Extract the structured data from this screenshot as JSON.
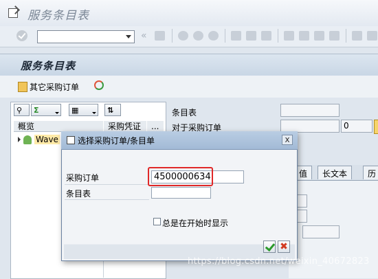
{
  "window": {
    "title": "服务条目表"
  },
  "toolbar": {
    "command_field_value": "",
    "nav_glyph": "«"
  },
  "screen": {
    "header": "服务条目表"
  },
  "app_toolbar": {
    "other_po_label": "其它采购订单"
  },
  "tree": {
    "col_overview": "概览",
    "col_po": "采购凭证",
    "col_more": "...",
    "row_label": "Wave"
  },
  "form": {
    "entry_sheet_label": "条目表",
    "for_po_label": "对于采购订单",
    "for_po_item": "0",
    "tabs": [
      "值",
      "长文本",
      "历"
    ]
  },
  "dialog": {
    "title": "选择采购订单/条目单",
    "close_glyph": "x",
    "po_label": "采购订单",
    "po_value": "4500000634",
    "entry_sheet_label": "条目表",
    "entry_sheet_value": "",
    "checkbox_label": "总是在开始时显示",
    "checkbox_checked": false,
    "cancel_glyph": "✖"
  },
  "watermark": "https://blog.csdn.net/weixin_40672823",
  "colors": {
    "highlight": "#e02828",
    "header_band": "#c8d6e5",
    "ok_green": "#2b9a2b",
    "cancel_red": "#d23a20"
  }
}
